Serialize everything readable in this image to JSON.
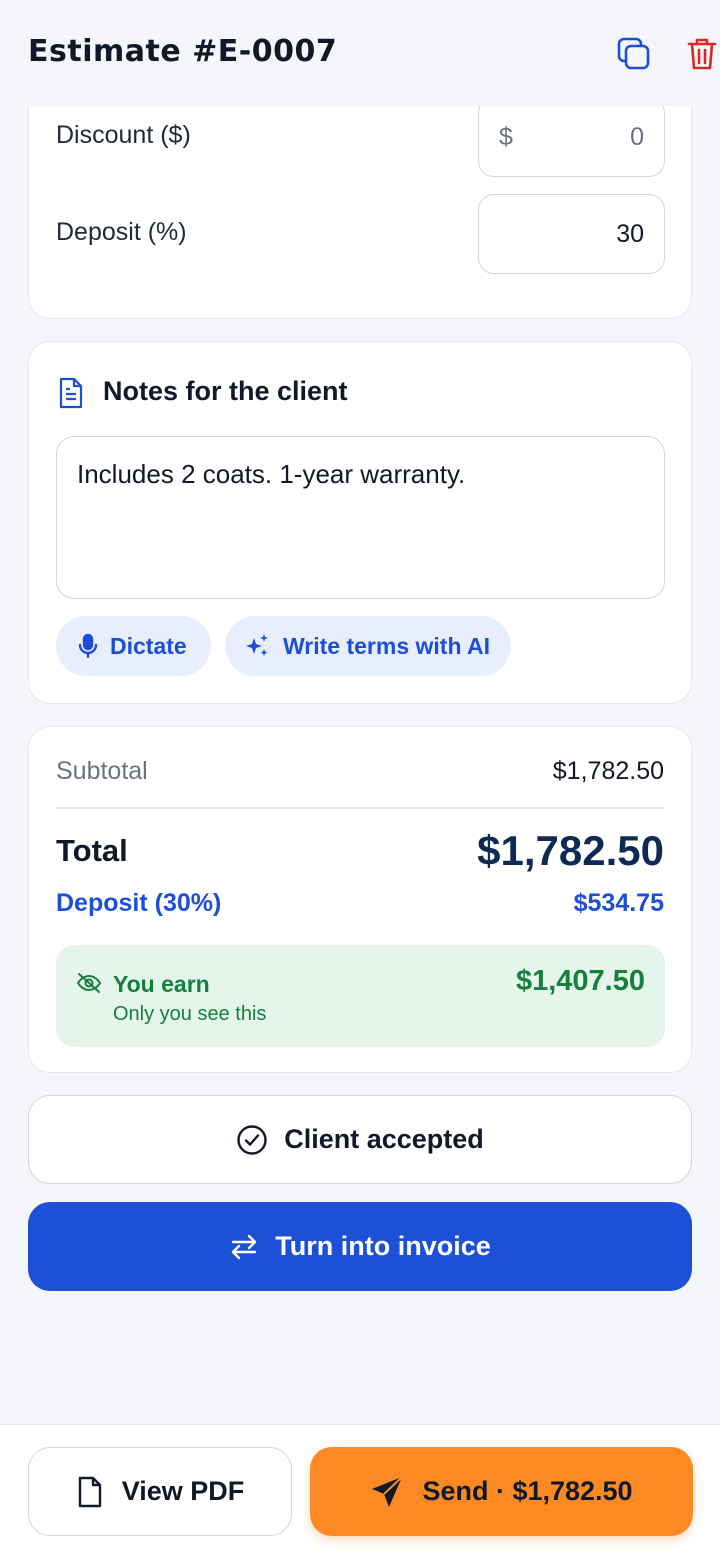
{
  "header": {
    "title": "Estimate #E-0007",
    "copy_icon": "copy-icon",
    "delete_icon": "trash-icon"
  },
  "pricing_fields": {
    "discount": {
      "label": "Discount ($)",
      "prefix": "$",
      "value": "0"
    },
    "deposit": {
      "label": "Deposit (%)",
      "value": "30"
    }
  },
  "notes": {
    "title": "Notes for the client",
    "icon": "document-icon",
    "text": "Includes 2 coats. 1-year warranty.",
    "dictate_label": "Dictate",
    "ai_label": "Write terms with AI"
  },
  "totals": {
    "subtotal_label": "Subtotal",
    "subtotal_value": "$1,782.50",
    "total_label": "Total",
    "total_value": "$1,782.50",
    "deposit_label": "Deposit (30%)",
    "deposit_value": "$534.75",
    "earn_title": "You earn",
    "earn_sub": "Only you see this",
    "earn_value": "$1,407.50"
  },
  "actions": {
    "accepted_label": "Client accepted",
    "invoice_label": "Turn into invoice",
    "pdf_label": "View PDF",
    "send_label": "Send · $1,782.50"
  },
  "colors": {
    "primary_blue": "#1d4fd7",
    "send_orange": "#fb8a24",
    "earn_green": "#15803d",
    "delete_red": "#dc2626"
  }
}
